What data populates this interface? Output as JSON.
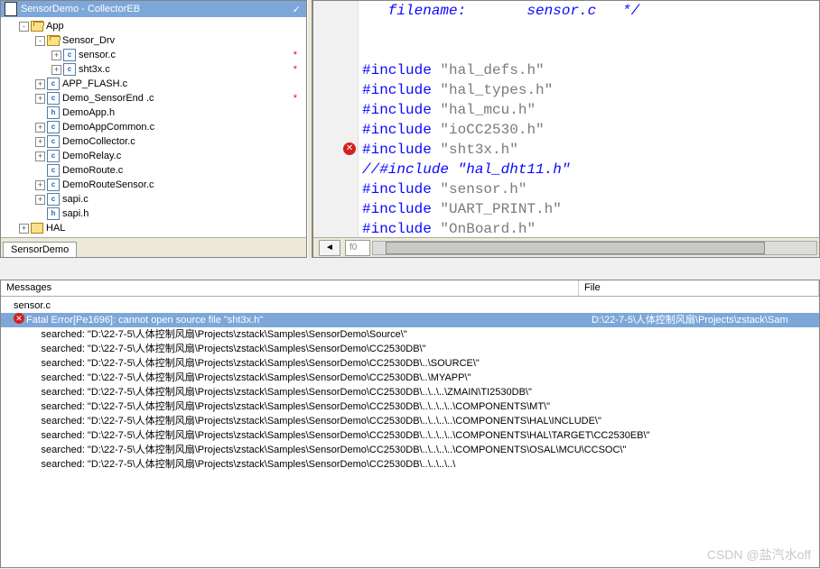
{
  "project": {
    "title": "SensorDemo - CollectorEB",
    "checkmark": "✓",
    "tab": "SensorDemo"
  },
  "tree": [
    {
      "depth": 1,
      "exp": "-",
      "icon": "folder-open",
      "label": "App",
      "mod": false
    },
    {
      "depth": 2,
      "exp": "-",
      "icon": "folder-open",
      "label": "Sensor_Drv",
      "mod": false
    },
    {
      "depth": 3,
      "exp": "+",
      "icon": "cfile",
      "label": "sensor.c",
      "mod": true
    },
    {
      "depth": 3,
      "exp": "+",
      "icon": "cfile",
      "label": "sht3x.c",
      "mod": true
    },
    {
      "depth": 2,
      "exp": "+",
      "icon": "cfile",
      "label": "APP_FLASH.c",
      "mod": false
    },
    {
      "depth": 2,
      "exp": "+",
      "icon": "cfile",
      "label": "Demo_SensorEnd .c",
      "mod": true
    },
    {
      "depth": 2,
      "exp": "",
      "icon": "hfile",
      "label": "DemoApp.h",
      "mod": false
    },
    {
      "depth": 2,
      "exp": "+",
      "icon": "cfile",
      "label": "DemoAppCommon.c",
      "mod": false
    },
    {
      "depth": 2,
      "exp": "+",
      "icon": "cfile",
      "label": "DemoCollector.c",
      "mod": false
    },
    {
      "depth": 2,
      "exp": "+",
      "icon": "cfile",
      "label": "DemoRelay.c",
      "mod": false
    },
    {
      "depth": 2,
      "exp": "",
      "icon": "cfile",
      "label": "DemoRoute.c",
      "mod": false
    },
    {
      "depth": 2,
      "exp": "+",
      "icon": "cfile",
      "label": "DemoRouteSensor.c",
      "mod": false
    },
    {
      "depth": 2,
      "exp": "+",
      "icon": "cfile",
      "label": "sapi.c",
      "mod": false
    },
    {
      "depth": 2,
      "exp": "",
      "icon": "hfile",
      "label": "sapi.h",
      "mod": false
    },
    {
      "depth": 1,
      "exp": "+",
      "icon": "folder",
      "label": "HAL",
      "mod": false
    }
  ],
  "code": {
    "frag_top": "   filename:       sensor.c   */",
    "lines": [
      {
        "t": "inc",
        "text": "\"hal_defs.h\"",
        "err": false
      },
      {
        "t": "inc",
        "text": "\"hal_types.h\"",
        "err": false
      },
      {
        "t": "inc",
        "text": "\"hal_mcu.h\"",
        "err": false
      },
      {
        "t": "inc",
        "text": "\"ioCC2530.h\"",
        "err": false
      },
      {
        "t": "inc",
        "text": "\"sht3x.h\"",
        "err": true
      },
      {
        "t": "cm",
        "text": "//#include \"hal_dht11.h\"",
        "err": false
      },
      {
        "t": "inc",
        "text": "\"sensor.h\"",
        "err": false
      },
      {
        "t": "inc",
        "text": "\"UART_PRINT.h\"",
        "err": false
      },
      {
        "t": "inc",
        "text": "\"OnBoard.h\"",
        "err": false
      }
    ],
    "include_kw": "#include",
    "status_label": "f0"
  },
  "messages": {
    "col1": "Messages",
    "col2": "File",
    "first_line": "sensor.c",
    "error": {
      "msg": "Fatal Error[Pe1696]: cannot open source file \"sht3x.h\"",
      "file": "D:\\22-7-5\\人体控制风扇\\Projects\\zstack\\Sam"
    },
    "searched": [
      "          searched: \"D:\\22-7-5\\人体控制风扇\\Projects\\zstack\\Samples\\SensorDemo\\Source\\\"",
      "          searched: \"D:\\22-7-5\\人体控制风扇\\Projects\\zstack\\Samples\\SensorDemo\\CC2530DB\\\"",
      "          searched: \"D:\\22-7-5\\人体控制风扇\\Projects\\zstack\\Samples\\SensorDemo\\CC2530DB\\..\\SOURCE\\\"",
      "          searched: \"D:\\22-7-5\\人体控制风扇\\Projects\\zstack\\Samples\\SensorDemo\\CC2530DB\\..\\MYAPP\\\"",
      "          searched: \"D:\\22-7-5\\人体控制风扇\\Projects\\zstack\\Samples\\SensorDemo\\CC2530DB\\..\\..\\..\\ZMAIN\\TI2530DB\\\"",
      "          searched: \"D:\\22-7-5\\人体控制风扇\\Projects\\zstack\\Samples\\SensorDemo\\CC2530DB\\..\\..\\..\\..\\COMPONENTS\\MT\\\"",
      "          searched: \"D:\\22-7-5\\人体控制风扇\\Projects\\zstack\\Samples\\SensorDemo\\CC2530DB\\..\\..\\..\\..\\COMPONENTS\\HAL\\INCLUDE\\\"",
      "          searched: \"D:\\22-7-5\\人体控制风扇\\Projects\\zstack\\Samples\\SensorDemo\\CC2530DB\\..\\..\\..\\..\\COMPONENTS\\HAL\\TARGET\\CC2530EB\\\"",
      "          searched: \"D:\\22-7-5\\人体控制风扇\\Projects\\zstack\\Samples\\SensorDemo\\CC2530DB\\..\\..\\..\\..\\COMPONENTS\\OSAL\\MCU\\CCSOC\\\"",
      "          searched: \"D:\\22-7-5\\人体控制风扇\\Projects\\zstack\\Samples\\SensorDemo\\CC2530DB\\..\\..\\..\\..\\"
    ]
  },
  "watermark": "CSDN @盐汽水off"
}
